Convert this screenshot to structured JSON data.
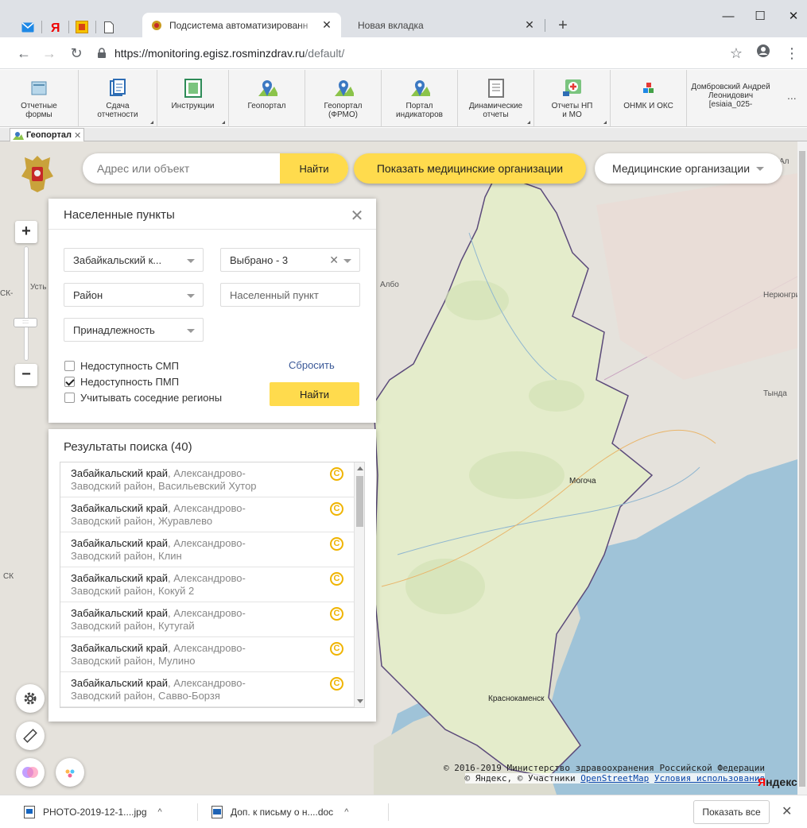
{
  "browser": {
    "active_tab_title": "Подсистема автоматизированн",
    "new_tab_title": "Новая вкладка",
    "url_host": "https://monitoring.egisz.rosminzdrav.ru",
    "url_path": "/default/"
  },
  "ribbon": {
    "items": [
      {
        "label": "Отчетные формы"
      },
      {
        "label": "Сдача отчетности"
      },
      {
        "label": "Инструкции"
      },
      {
        "label": "Геопортал"
      },
      {
        "label": "Геопортал (ФРМО)"
      },
      {
        "label": "Портал индикаторов"
      },
      {
        "label": "Динамические отчеты"
      },
      {
        "label": "Отчеты НП и МО"
      },
      {
        "label": "ОНМК И ОКС"
      }
    ],
    "user": "Домбровский Андрей Леонидович [esiaia_025-",
    "more": "..."
  },
  "doc_tab": {
    "label": "Геопортал"
  },
  "map": {
    "search_placeholder": "Адрес или объект",
    "search_button": "Найти",
    "show_orgs_button": "Показать медицинские организации",
    "orgs_select": "Медицинские организации",
    "labels": {
      "mogocha": "Могоча",
      "krasnokamensk": "Краснокаменск",
      "neryungri": "Нерюнгри",
      "tynda": "Тында",
      "ust": "Усть",
      "albo": "Албо",
      "ck1": "СК-",
      "ck2": "СК",
      "al": "Ал"
    },
    "copyright_line1": "© 2016-2019 Министерство здравоохранения Российской Федерации",
    "copyright_prefix": "© Яндекс, © Участники ",
    "copyright_osm": "OpenStreetMap",
    "copyright_terms": "Условия использования",
    "yandex_logo_ya": "Я",
    "yandex_logo_rest": "ндекс"
  },
  "loc_panel": {
    "title": "Населенные пункты",
    "region_value": "Забайкальский к...",
    "selected_value": "Выбрано - 3",
    "district_value": "Район",
    "locality_placeholder": "Населенный пункт",
    "affiliation_value": "Принадлежность",
    "checkboxes": [
      {
        "label": "Недоступность СМП",
        "checked": false
      },
      {
        "label": "Недоступность ПМП",
        "checked": true
      },
      {
        "label": "Учитывать соседние регионы",
        "checked": false
      }
    ],
    "reset_label": "Сбросить",
    "find_label": "Найти"
  },
  "results": {
    "title": "Результаты поиска (40)",
    "items": [
      {
        "region": "Забайкальский край",
        "line1_rest": ", Александрово-",
        "line2": "Заводский район, Васильевский Хутор"
      },
      {
        "region": "Забайкальский край",
        "line1_rest": ", Александрово-",
        "line2": "Заводский район, Журавлево"
      },
      {
        "region": "Забайкальский край",
        "line1_rest": ", Александрово-",
        "line2": "Заводский район, Клин"
      },
      {
        "region": "Забайкальский край",
        "line1_rest": ", Александрово-",
        "line2": "Заводский район, Кокуй 2"
      },
      {
        "region": "Забайкальский край",
        "line1_rest": ", Александрово-",
        "line2": "Заводский район, Кутугай"
      },
      {
        "region": "Забайкальский край",
        "line1_rest": ", Александрово-",
        "line2": "Заводский район, Мулино"
      },
      {
        "region": "Забайкальский край",
        "line1_rest": ", Александрово-",
        "line2": "Заводский район, Савво-Борзя"
      }
    ]
  },
  "downloads": {
    "items": [
      {
        "name": "PHOTO-2019-12-1....jpg"
      },
      {
        "name": "Доп. к письму о н....doc"
      }
    ],
    "show_all": "Показать все"
  },
  "colors": {
    "accent_yellow": "#ffdb4d",
    "region_fill": "#e4eccb",
    "water": "#9fc3d8",
    "map_bg": "#e5e2dc"
  }
}
